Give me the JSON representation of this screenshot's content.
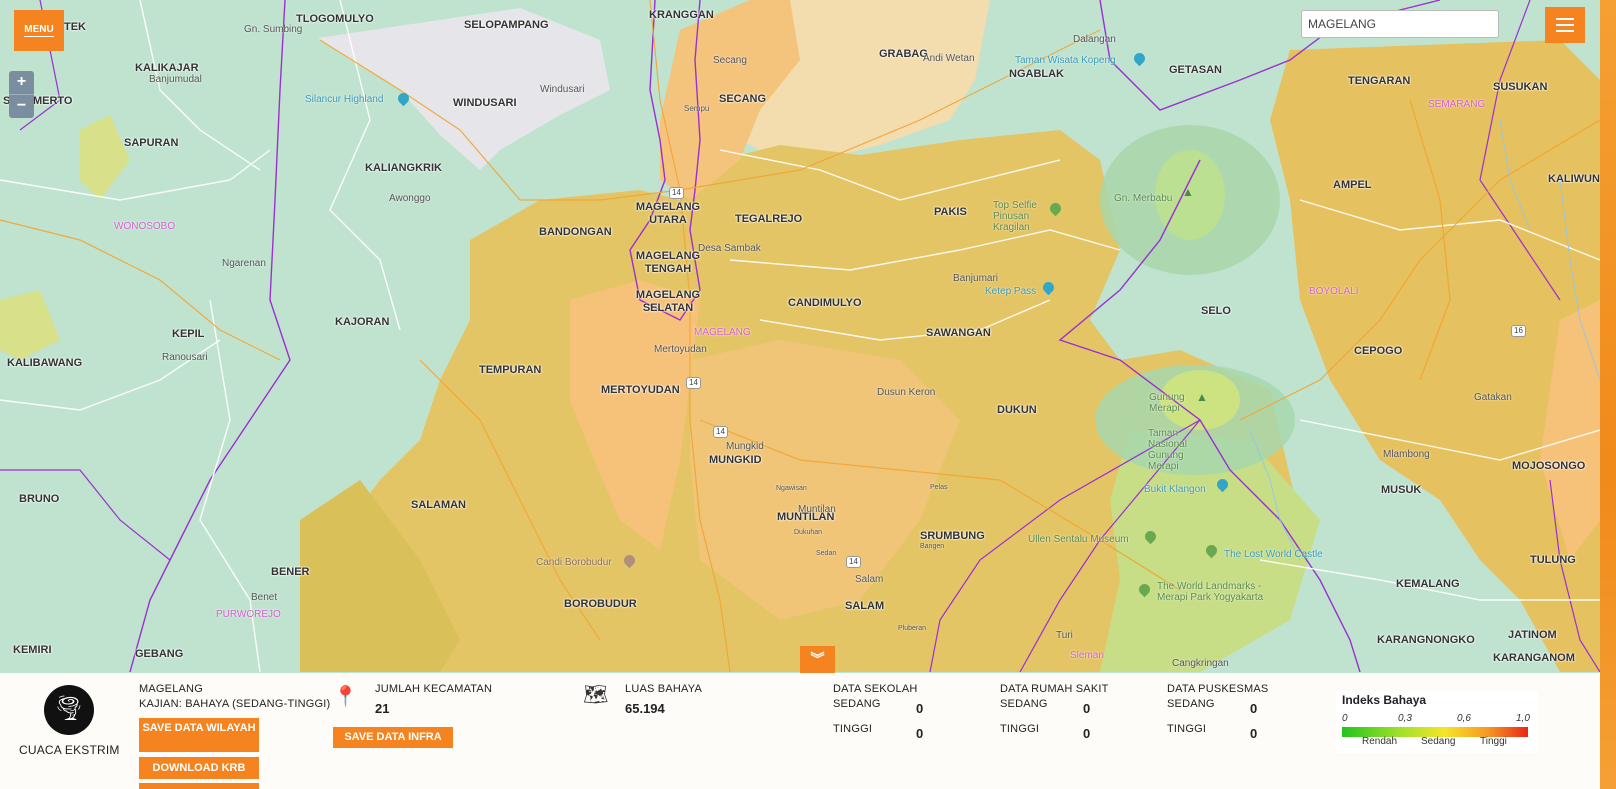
{
  "map": {
    "towns": [
      {
        "text": "TEK"
      },
      {
        "text": "TLOGOMULYO"
      },
      {
        "text": "SELOPAMPANG"
      },
      {
        "text": "KRANGGAN"
      },
      {
        "text": "GRABAG"
      },
      {
        "text": "NGABLAK"
      },
      {
        "text": "GETASAN"
      },
      {
        "text": "TENGARAN"
      },
      {
        "text": "SUSUKAN"
      },
      {
        "text": "KALIKAJAR"
      },
      {
        "text": "SELOMERTO"
      },
      {
        "text": "WINDUSARI"
      },
      {
        "text": "SECANG"
      },
      {
        "text": "SAPURAN"
      },
      {
        "text": "KALIANGKRIK"
      },
      {
        "text": "AMPEL"
      },
      {
        "text": "KALIWUNGU"
      },
      {
        "text": "BANDONGAN"
      },
      {
        "text": "MAGELANG UTARA"
      },
      {
        "text": "TEGALREJO"
      },
      {
        "text": "PAKIS"
      },
      {
        "text": "MAGELANG TENGAH"
      },
      {
        "text": "MAGELANG SELATAN"
      },
      {
        "text": "CANDIMULYO"
      },
      {
        "text": "SELO"
      },
      {
        "text": "KAJORAN"
      },
      {
        "text": "SAWANGAN"
      },
      {
        "text": "CEPOGO"
      },
      {
        "text": "KEPIL"
      },
      {
        "text": "KALIBAWANG"
      },
      {
        "text": "TEMPURAN"
      },
      {
        "text": "MERTOYUDAN"
      },
      {
        "text": "DUKUN"
      },
      {
        "text": "MUNGKID"
      },
      {
        "text": "MOJOSONGO"
      },
      {
        "text": "BRUNO"
      },
      {
        "text": "SALAMAN"
      },
      {
        "text": "MUNTILAN"
      },
      {
        "text": "MUSUK"
      },
      {
        "text": "SRUMBUNG"
      },
      {
        "text": "BENER"
      },
      {
        "text": "TULUNG"
      },
      {
        "text": "KEMALANG"
      },
      {
        "text": "BOROBUDUR"
      },
      {
        "text": "SALAM"
      },
      {
        "text": "KEMIRI"
      },
      {
        "text": "GEBANG"
      },
      {
        "text": "JATINOM"
      },
      {
        "text": "KARANGNONGKO"
      },
      {
        "text": "KARANGANOM"
      }
    ],
    "places": [
      "Gn. Sumbing",
      "Banjumudal",
      "Windusari",
      "Secang",
      "Sempu",
      "Dalangan",
      "Andi Wetan",
      "Awonggo",
      "Ngarenan",
      "Desa Sambak",
      "Banjumari",
      "Mertoyudan",
      "Ranousari",
      "Dusun Keron",
      "Mungkid",
      "Mlambong",
      "Gatakan",
      "Muntilan",
      "Salam",
      "Turi",
      "Cangkringan",
      "Benet",
      "Dukuhan",
      "Ngawisan",
      "Pelas",
      "Bangen",
      "Pluberan",
      "Sedan"
    ],
    "pink_labels": [
      "WONOSOBO",
      "MAGELANG",
      "SEMARANG",
      "BOYOLALI",
      "PURWOREJO",
      "Sleman"
    ],
    "pois": [
      "Taman Wisata Kopeng",
      "Silancur Highland",
      "Ketep Pass",
      "Bukit Klangon",
      "The Lost World Castle"
    ],
    "pois_green": [
      "Top Selfie Pinusan Kragilan",
      "Gn. Merbabu",
      "Gunung Merapi",
      "Taman Nasional Gunung Merapi",
      "Ullen Sentalu Museum",
      "The World Landmarks - Merapi Park Yogyakarta",
      "Candi Borobudur"
    ],
    "roads": [
      "14",
      "14",
      "14",
      "14",
      "16"
    ]
  },
  "controls": {
    "menu_label": "MENU",
    "zoom_in": "+",
    "zoom_out": "−",
    "search_value": "MAGELANG",
    "collapse_icon": "chevron-down-double"
  },
  "panel": {
    "weather_label": "CUACA EKSTRIM",
    "region": "MAGELANG",
    "kajian": "KAJIAN: BAHAYA (SEDANG-TINGGI)",
    "save_wilayah": "SAVE DATA WILAYAH",
    "download_krb": "DOWNLOAD KRB",
    "jumlah_label": "JUMLAH KECAMATAN",
    "jumlah_value": "21",
    "save_infra": "SAVE DATA INFRA",
    "luas_label": "LUAS BAHAYA",
    "luas_value": "65.194",
    "sekolah": {
      "title": "DATA SEKOLAH",
      "sedang": "SEDANG",
      "sedang_val": "0",
      "tinggi": "TINGGI",
      "tinggi_val": "0"
    },
    "rumah_sakit": {
      "title": "DATA RUMAH SAKIT",
      "sedang": "SEDANG",
      "sedang_val": "0",
      "tinggi": "TINGGI",
      "tinggi_val": "0"
    },
    "puskesmas": {
      "title": "DATA PUSKESMAS",
      "sedang": "SEDANG",
      "sedang_val": "0",
      "tinggi": "TINGGI",
      "tinggi_val": "0"
    }
  },
  "legend": {
    "title": "Indeks Bahaya",
    "ticks": [
      "0",
      "0,3",
      "0,6",
      "1,0"
    ],
    "labels": [
      "Rendah",
      "Sedang",
      "Tinggi"
    ],
    "colors": [
      "#22c41c",
      "#f5e52a",
      "#e8271a"
    ]
  },
  "colors": {
    "accent": "#f5831f",
    "low": "#bfe3cf",
    "medium": "#e9c468",
    "medium_high": "#f6c27a",
    "no_data": "#e6e6ea",
    "boundary": "#9b2fd1"
  }
}
